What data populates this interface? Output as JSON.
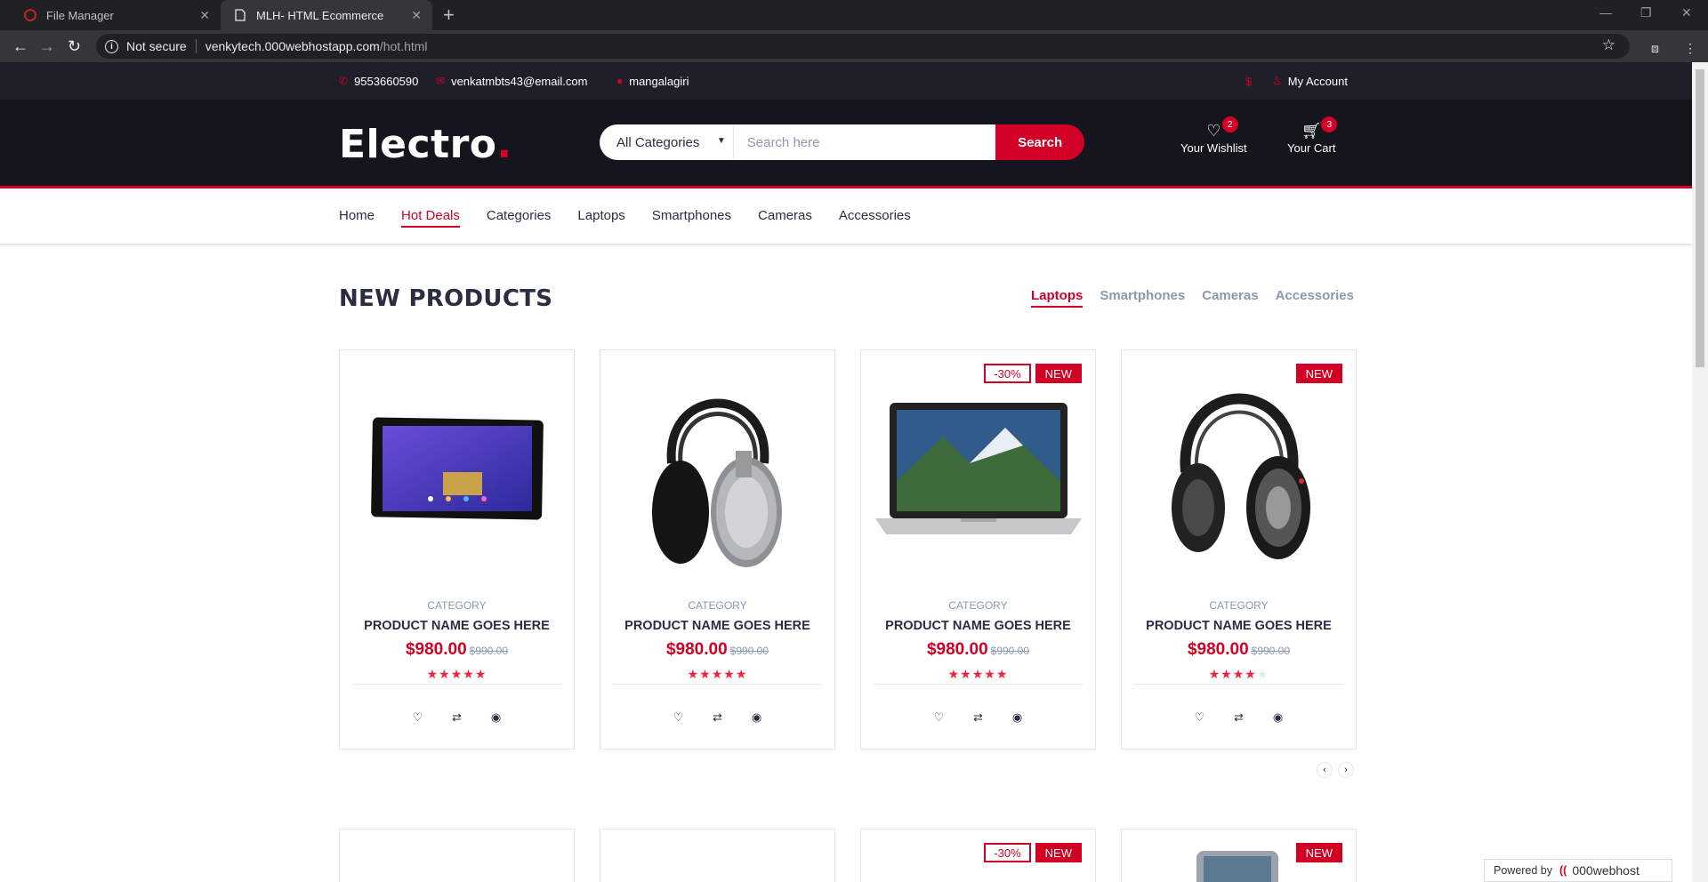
{
  "browser": {
    "tabs": [
      {
        "title": "File Manager",
        "active": false
      },
      {
        "title": "MLH- HTML Ecommerce",
        "active": true
      }
    ],
    "not_secure": "Not secure",
    "url_host": "venkytech.000webhostapp.com",
    "url_path": "/hot.html"
  },
  "top_header": {
    "phone": "9553660590",
    "email": "venkatmbts43@email.com",
    "location": "mangalagiri",
    "currency": "$",
    "account": "My Account"
  },
  "header": {
    "logo": "Electro",
    "logo_dot": ".",
    "category_select": "All Categories",
    "search_placeholder": "Search here",
    "search_button": "Search",
    "wishlist_label": "Your Wishlist",
    "wishlist_qty": "2",
    "cart_label": "Your Cart",
    "cart_qty": "3"
  },
  "nav": {
    "items": [
      "Home",
      "Hot Deals",
      "Categories",
      "Laptops",
      "Smartphones",
      "Cameras",
      "Accessories"
    ],
    "active": "Hot Deals"
  },
  "section": {
    "title": "NEW PRODUCTS",
    "tabs": [
      "Laptops",
      "Smartphones",
      "Cameras",
      "Accessories"
    ],
    "active_tab": "Laptops"
  },
  "products": [
    {
      "image": "tablet-image",
      "category": "CATEGORY",
      "name": "PRODUCT NAME GOES HERE",
      "price": "$980.00",
      "old_price": "$990.00",
      "rating": 5,
      "sale": "",
      "new": ""
    },
    {
      "image": "headphones-image",
      "category": "CATEGORY",
      "name": "PRODUCT NAME GOES HERE",
      "price": "$980.00",
      "old_price": "$990.00",
      "rating": 5,
      "sale": "",
      "new": ""
    },
    {
      "image": "laptop-image",
      "category": "CATEGORY",
      "name": "PRODUCT NAME GOES HERE",
      "price": "$980.00",
      "old_price": "$990.00",
      "rating": 5,
      "sale": "-30%",
      "new": "NEW"
    },
    {
      "image": "studio-headphones-image",
      "category": "CATEGORY",
      "name": "PRODUCT NAME GOES HERE",
      "price": "$980.00",
      "old_price": "$990.00",
      "rating": 4,
      "sale": "",
      "new": "NEW"
    }
  ],
  "next_row_labels": {
    "sale": "-30%",
    "new": "NEW"
  },
  "footer_badge": {
    "powered": "Powered by",
    "brand": "000webhost"
  },
  "colors": {
    "accent": "#d10024",
    "header_bg": "#15161d",
    "top_header_bg": "#1e1f29",
    "text": "#2b2d42",
    "muted": "#8d99ae"
  }
}
